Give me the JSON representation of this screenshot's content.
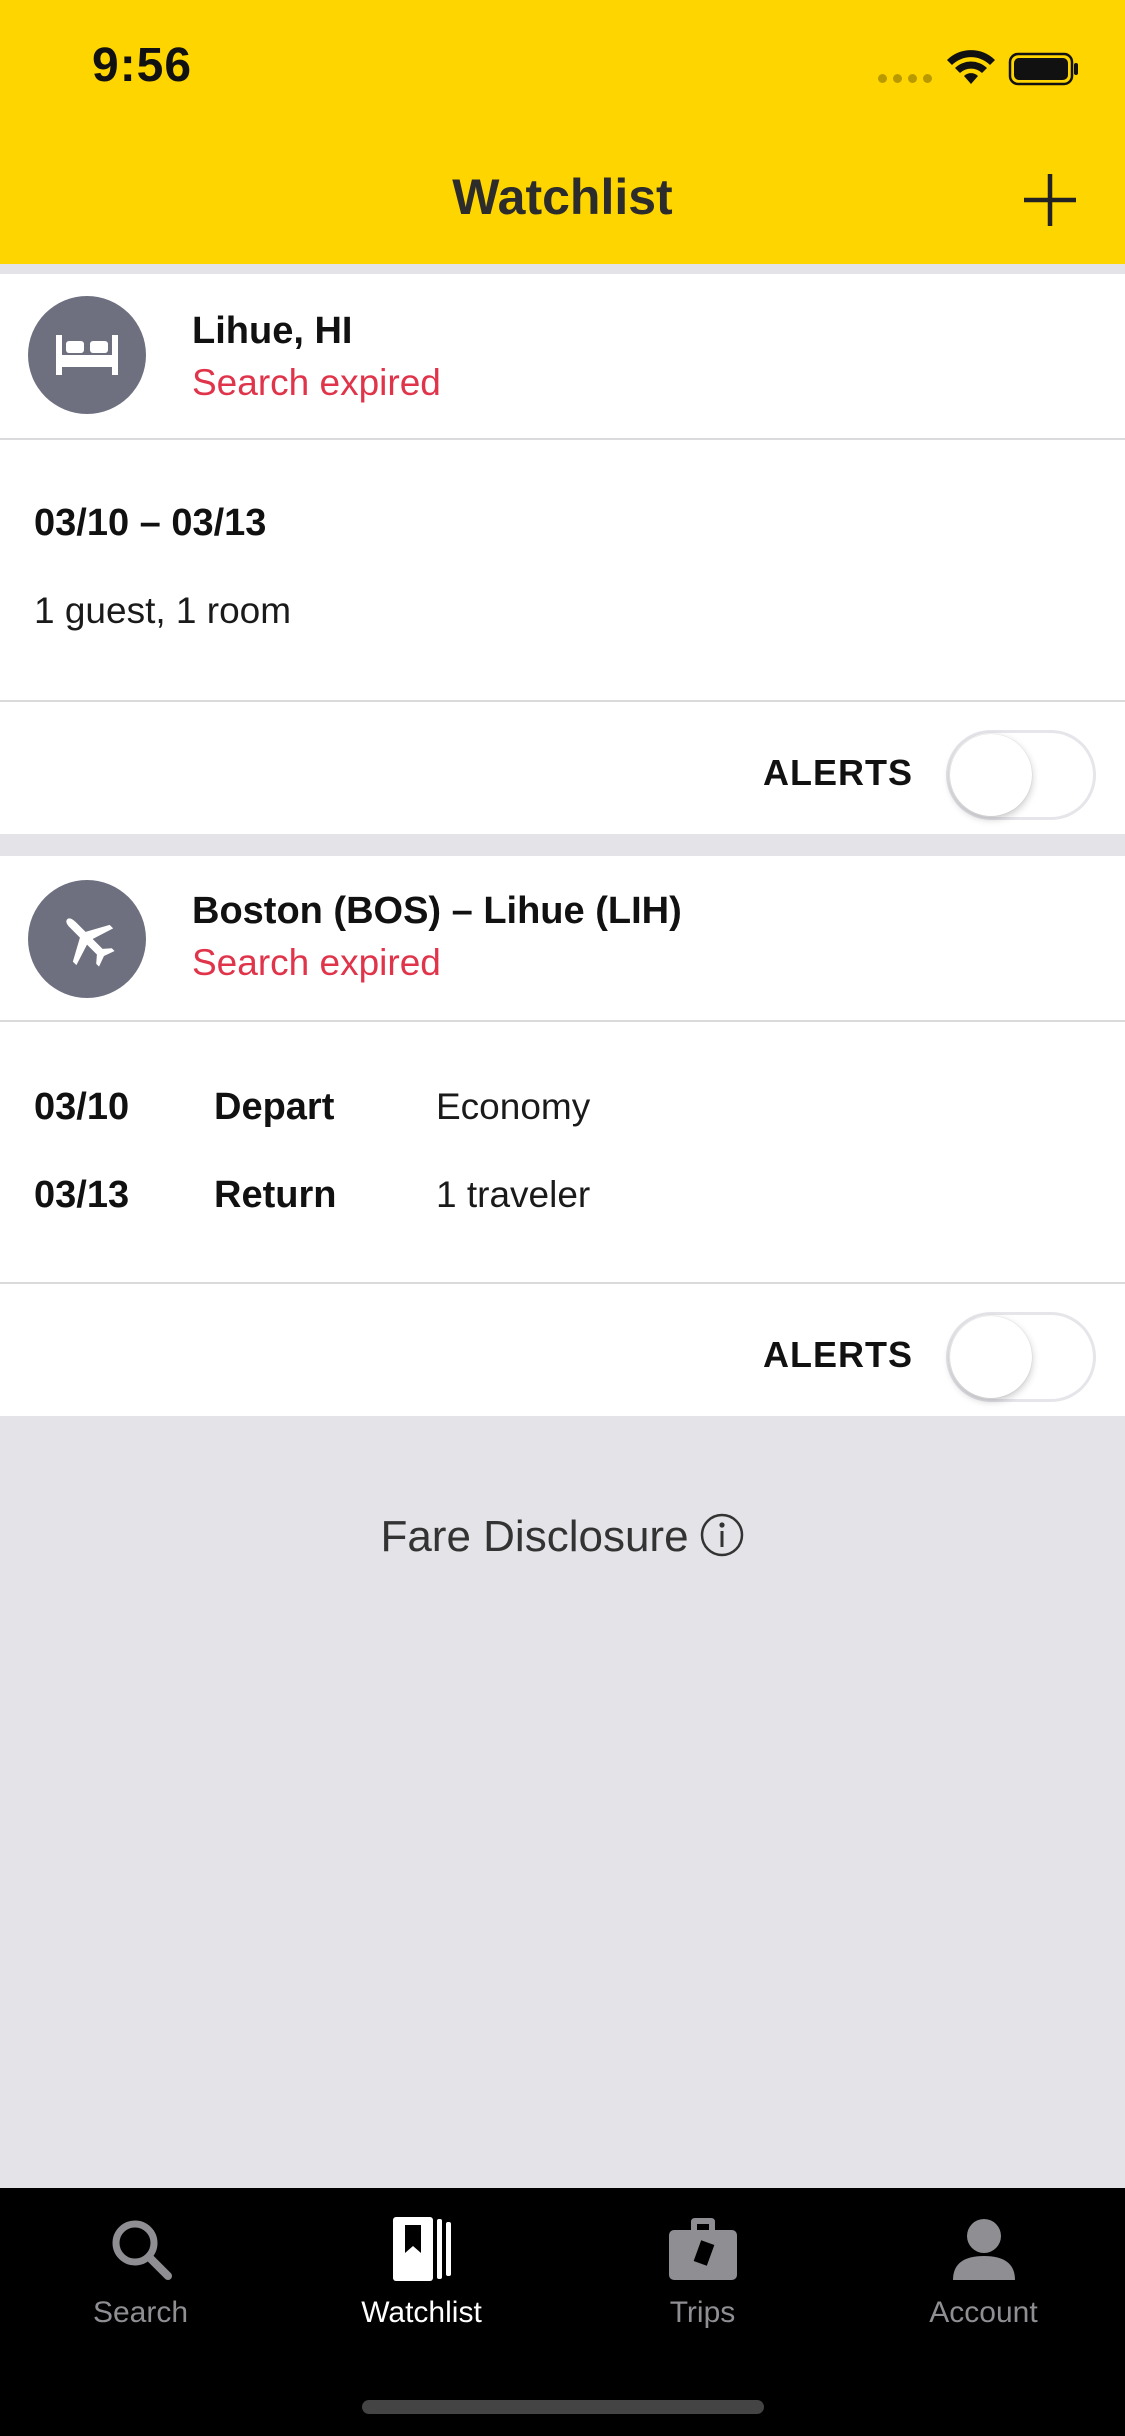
{
  "status_bar": {
    "time": "9:56"
  },
  "header": {
    "title": "Watchlist",
    "add_icon": "plus-icon"
  },
  "hotel_item": {
    "icon": "bed-icon",
    "title": "Lihue, HI",
    "status": "Search expired",
    "dates": "03/10 – 03/13",
    "guests": "1 guest, 1 room",
    "alerts_label": "ALERTS",
    "alerts_on": false
  },
  "flight_item": {
    "icon": "airplane-icon",
    "title": "Boston (BOS) – Lihue (LIH)",
    "status": "Search expired",
    "legs": [
      {
        "date": "03/10",
        "type": "Depart",
        "info": "Economy"
      },
      {
        "date": "03/13",
        "type": "Return",
        "info": "1 traveler"
      }
    ],
    "alerts_label": "ALERTS",
    "alerts_on": false
  },
  "fare_disclosure": {
    "label": "Fare Disclosure",
    "icon": "info-icon"
  },
  "tab_bar": {
    "active": "Watchlist",
    "tabs": [
      {
        "label": "Search",
        "icon": "search-icon"
      },
      {
        "label": "Watchlist",
        "icon": "watchlist-icon"
      },
      {
        "label": "Trips",
        "icon": "briefcase-icon"
      },
      {
        "label": "Account",
        "icon": "person-icon"
      }
    ]
  },
  "colors": {
    "header_yellow": "#FFD500",
    "status_red": "#E0344B",
    "background_gray": "#E3E3E8",
    "tab_bar_black": "#000000",
    "avatar_gray": "#6E7080"
  }
}
